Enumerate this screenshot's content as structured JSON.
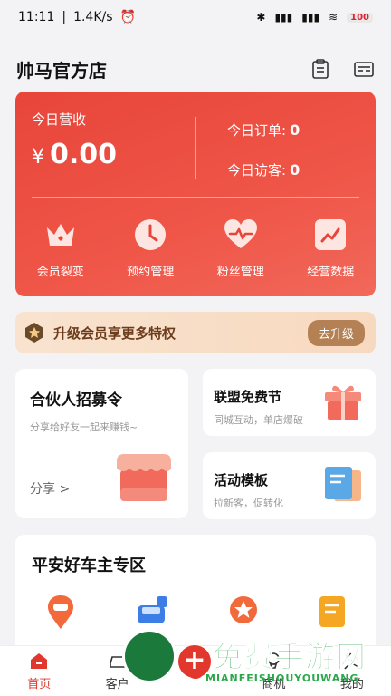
{
  "status_bar": {
    "time": "11:11",
    "network_speed": "1.4K/s",
    "battery": "100"
  },
  "header": {
    "title": "帅马官方店"
  },
  "revenue": {
    "label": "今日营收",
    "currency": "¥",
    "amount": "0.00",
    "orders_label": "今日订单:",
    "orders_value": "0",
    "visitors_label": "今日访客:",
    "visitors_value": "0"
  },
  "quick_actions": [
    {
      "label": "会员裂变",
      "icon": "crown-icon"
    },
    {
      "label": "预约管理",
      "icon": "clock-icon"
    },
    {
      "label": "粉丝管理",
      "icon": "heart-pulse-icon"
    },
    {
      "label": "经营数据",
      "icon": "chart-icon"
    }
  ],
  "vip_banner": {
    "text": "升级会员享更多特权",
    "button": "去升级"
  },
  "partner_card": {
    "title": "合伙人招募令",
    "subtitle": "分享给好友一起来赚钱~",
    "link": "分享 >"
  },
  "alliance_card": {
    "title": "联盟免费节",
    "subtitle": "同城互动，单店爆破"
  },
  "template_card": {
    "title": "活动模板",
    "subtitle": "拉新客，促转化"
  },
  "zone": {
    "title": "平安好车主专区"
  },
  "tabbar": [
    {
      "label": "首页",
      "icon": "home-icon"
    },
    {
      "label": "客户",
      "icon": "car-icon"
    },
    {
      "label": "",
      "icon": "add-icon"
    },
    {
      "label": "商机",
      "icon": "bulb-icon"
    },
    {
      "label": "我的",
      "icon": "user-icon"
    }
  ],
  "watermark": {
    "text": "免费手游网",
    "sub": "MIANFEISHOUYOUWANG"
  },
  "colors": {
    "primary_red": "#e8453a",
    "vip_gold": "#b48154",
    "watermark_green": "#2aa84a"
  }
}
